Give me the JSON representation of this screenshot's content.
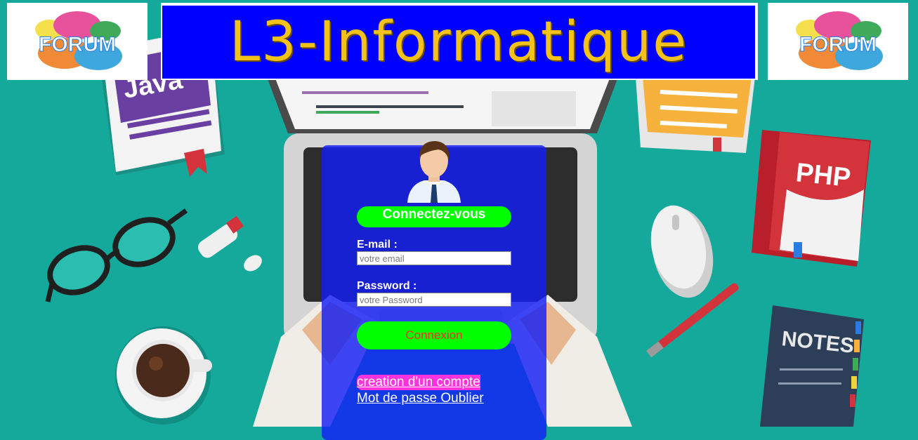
{
  "header": {
    "logo_left_text": "FORUM",
    "banner_title": "L3-Informatique",
    "logo_right_text": "FORUM"
  },
  "background": {
    "book_java_label": "Java",
    "book_php_label": "PHP",
    "notebook_label": "NOTES"
  },
  "login": {
    "heading": "Connectez-vous",
    "email_label": "E-mail :",
    "email_placeholder": "votre email",
    "email_value": "",
    "password_label": "Password :",
    "password_placeholder": "votre Password",
    "password_value": "",
    "submit_label": "Connexion",
    "create_account_link": "creation d'un compte",
    "forgot_password_link": "Mot de passe Oublier"
  },
  "colors": {
    "background": "#15a99c",
    "banner_bg": "#0000ff",
    "banner_text": "#f2c21b",
    "panel_bg": "#141ef5",
    "accent_green": "#00ff00",
    "button_text": "#ff2a2a",
    "link_highlight": "#ff33dd"
  }
}
